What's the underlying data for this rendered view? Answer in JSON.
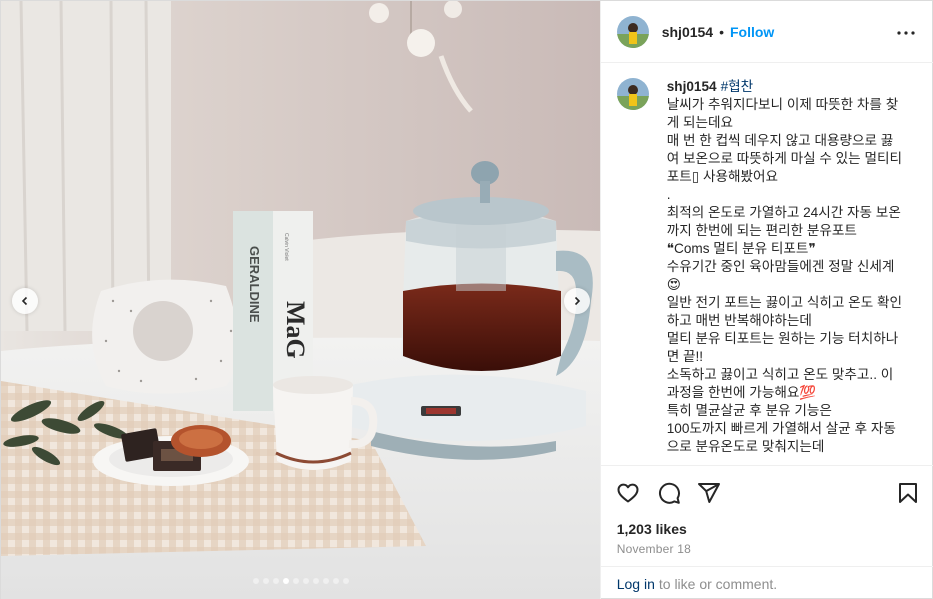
{
  "post": {
    "username": "shj0154",
    "separator": "•",
    "follow_label": "Follow",
    "more_icon": "more-horizontal-icon",
    "caption_user": "shj0154",
    "caption_tag": "#협찬",
    "caption_lines": [
      "날씨가 추워지다보니 이제 따뜻한 차를 찾게 되는데요",
      "매 번 한 컵씩 데우지 않고 대용량으로 끓여 보온으로 따뜻하게 마실 수 있는 멀티티포트▯ 사용해봤어요",
      ".",
      "최적의 온도로 가열하고 24시간 자동 보온까지 한번에 되는 편리한 분유포트",
      "❝Coms 멀티 분유 티포트❞",
      "수유기간 중인 육아맘들에겐 정말 신세계😍",
      "일반 전기 포트는 끓이고 식히고 온도 확인하고 매번 반복해야하는데",
      "멀티 분유 티포트는 원하는 기능 터치하나면 끝!!",
      "소독하고 끓이고 식히고 온도 맞추고.. 이 과정을 한번에 가능해요💯",
      "특히 멸균살균 후 분유 기능은",
      "100도까지 빠르게 가열해서 살균 후 자동으로 분유온도로 맞춰지는데"
    ],
    "likes": "1,203 likes",
    "date": "November 18",
    "login_link": "Log in",
    "login_rest": "to like or comment.",
    "photo": {
      "book_spine_1": "GERALDINE",
      "book_spine_2": "MaG",
      "book_small_text": "Calvin Violet",
      "carousel_total": 10,
      "carousel_active": 4
    },
    "colors": {
      "accent": "#0095f6",
      "link": "#00376b",
      "muted": "#8e8e8e"
    }
  }
}
